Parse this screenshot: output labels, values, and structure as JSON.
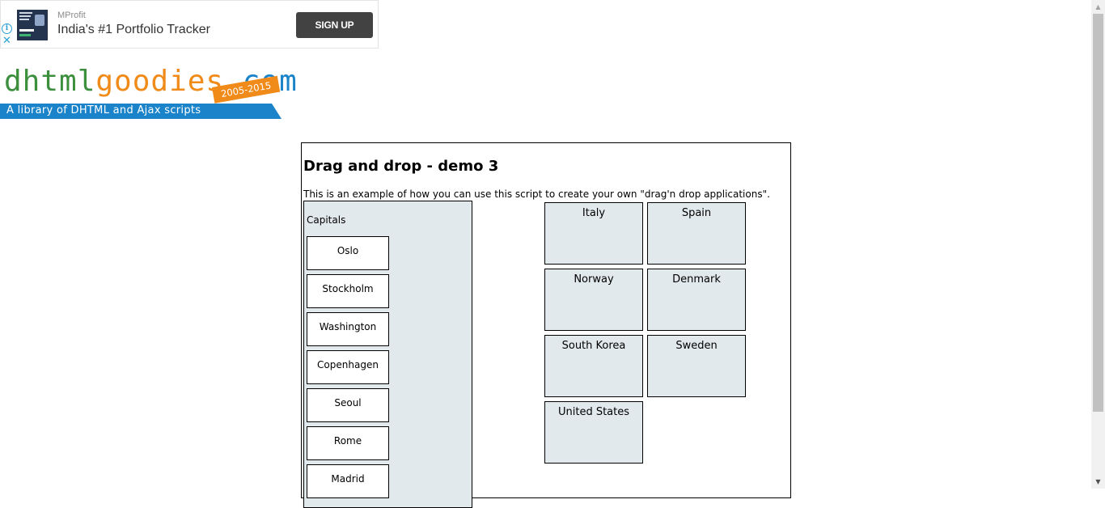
{
  "ad": {
    "info_glyph": "i",
    "close_glyph": "✕",
    "sponsor": "MProfit",
    "headline": "India's #1 Portfolio Tracker",
    "cta": "SIGN UP"
  },
  "logo": {
    "word_green": "dhtml",
    "word_orange": "goodies",
    "word_blue": ".com",
    "years": "2005-2015",
    "tagline": "A library of DHTML and Ajax scripts",
    "colors": {
      "green": "#3c8f3c",
      "orange": "#f08a19",
      "blue": "#1a83c9"
    }
  },
  "demo": {
    "title": "Drag and drop - demo 3",
    "description": "This is an example of how you can use this script to create your own \"drag'n drop applications\".",
    "capitals_title": "Capitals",
    "capitals": [
      "Oslo",
      "Stockholm",
      "Washington",
      "Copenhagen",
      "Seoul",
      "Rome",
      "Madrid"
    ],
    "countries": [
      "Italy",
      "Spain",
      "Norway",
      "Denmark",
      "South Korea",
      "Sweden",
      "United States"
    ],
    "colors": {
      "panel_bg": "#e2e9ec",
      "border": "#000000"
    }
  }
}
